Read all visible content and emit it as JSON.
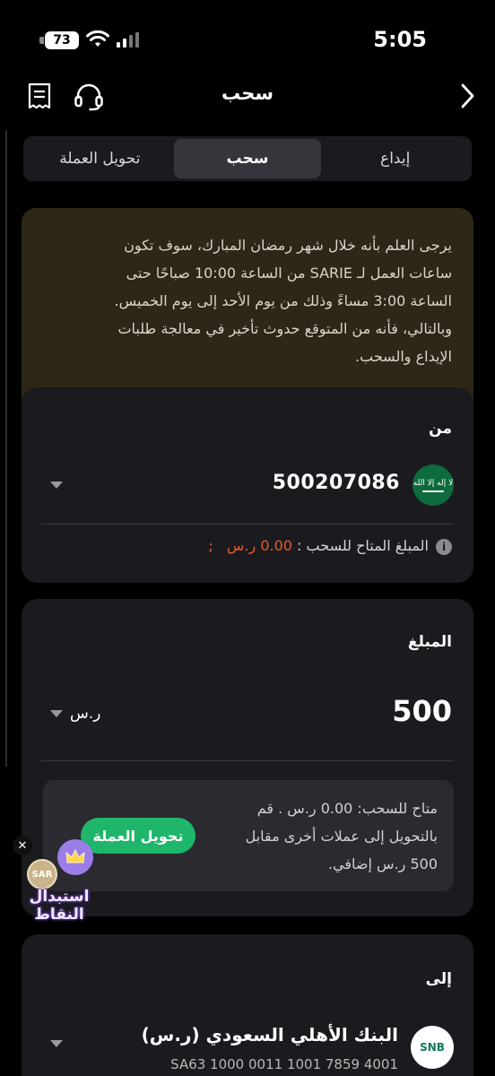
{
  "status_bar": {
    "battery": "73",
    "time": "5:05"
  },
  "header": {
    "title": "سحب"
  },
  "tabs": [
    {
      "label": "تحويل العملة",
      "active": false
    },
    {
      "label": "سحب",
      "active": true
    },
    {
      "label": "إيداع",
      "active": false
    }
  ],
  "notice": {
    "lines": [
      "يرجى العلم بأنه خلال شهر رمضان المبارك، سوف تكون",
      "ساعات العمل لـ SARIE من الساعة 10:00 صباحًا حتى",
      "الساعة 3:00 مساءً وذلك من يوم الأحد إلى يوم الخميس.",
      "وبالتالي، فأنه من المتوقع حدوث تأخير في معالجة طلبات",
      "الإيداع والسحب."
    ]
  },
  "from": {
    "label": "من",
    "account_number": "500207086",
    "flag_script": "لا إله إلا الله",
    "available_label": "المبلغ المتاح للسحب :",
    "available_amount": "0.00 ر.س",
    "available_suffix": ";"
  },
  "amount": {
    "label": "المبلغ",
    "value": "500",
    "currency": "ر.س",
    "info_lines": [
      "متاح للسحب: 0.00 ر.س . قم",
      "بالتحويل إلى عملات أخرى مقابل",
      "500 ر.س إضافي."
    ],
    "convert_button": "تحويل العملة"
  },
  "to": {
    "label": "إلى",
    "bank_logo": "SNB",
    "bank_name": "البنك الأهلي السعودي (ر.س)",
    "iban": "SA63 1000 0011 1001 7859 4001"
  },
  "points_badge": {
    "close": "✕",
    "coin": "SAR",
    "label_line1": "استبدال",
    "label_line2": "النقاط"
  }
}
